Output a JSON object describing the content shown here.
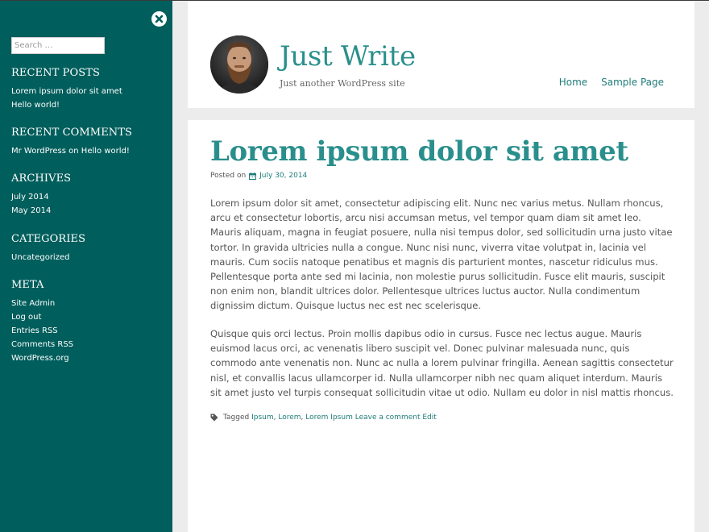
{
  "sidebar": {
    "search": {
      "placeholder": "Search …",
      "value": ""
    },
    "recent_posts": {
      "title": "Recent Posts",
      "items": [
        "Lorem ipsum dolor sit amet",
        "Hello world!"
      ]
    },
    "recent_comments": {
      "title": "Recent Comments",
      "author": "Mr WordPress",
      "connector": "on",
      "post": "Hello world!"
    },
    "archives": {
      "title": "Archives",
      "items": [
        "July 2014",
        "May 2014"
      ]
    },
    "categories": {
      "title": "Categories",
      "items": [
        "Uncategorized"
      ]
    },
    "meta": {
      "title": "Meta",
      "items": [
        "Site Admin",
        "Log out",
        "Entries RSS",
        "Comments RSS",
        "WordPress.org"
      ]
    }
  },
  "header": {
    "site_title": "Just Write",
    "site_description": "Just another WordPress site",
    "nav": [
      "Home",
      "Sample Page"
    ]
  },
  "post": {
    "title": "Lorem ipsum dolor sit amet",
    "posted_on_label": "Posted on",
    "date": "July 30, 2014",
    "paragraphs": [
      "Lorem ipsum dolor sit amet, consectetur adipiscing elit. Nunc nec varius metus. Nullam rhoncus, arcu et consectetur lobortis, arcu nisi accumsan metus, vel tempor quam diam sit amet leo. Mauris aliquam, magna in feugiat posuere, nulla nisi tempus dolor, sed sollicitudin urna justo vitae tortor. In gravida ultricies nulla a congue. Nunc nisi nunc, viverra vitae volutpat in, lacinia vel mauris. Cum sociis natoque penatibus et magnis dis parturient montes, nascetur ridiculus mus. Pellentesque porta ante sed mi lacinia, non molestie purus sollicitudin. Fusce elit mauris, suscipit non enim non, blandit ultrices dolor. Pellentesque ultrices luctus auctor. Nulla condimentum dignissim dictum. Quisque luctus nec est nec scelerisque.",
      "Quisque quis orci lectus. Proin mollis dapibus odio in cursus. Fusce nec lectus augue. Mauris euismod lacus orci, ac venenatis libero suscipit vel. Donec pulvinar malesuada nunc, quis commodo ante venenatis non. Nunc ac nulla a lorem pulvinar fringilla. Aenean sagittis consectetur nisl, et convallis lacus ullamcorper id. Nulla ullamcorper nibh nec quam aliquet interdum. Mauris sit amet justo vel turpis consequat sollicitudin vitae ut odio. Nullam eu dolor in nisl mattis rhoncus."
    ],
    "tagged_label": "Tagged",
    "tags": [
      "Ipsum",
      "Lorem",
      "Lorem Ipsum"
    ],
    "tag_separator": ",",
    "comment_link": "Leave a comment",
    "edit_link": "Edit"
  },
  "colors": {
    "sidebar_bg": "#005e5c",
    "accent": "#2a8f8c",
    "link": "#1f7d7a",
    "page_bg": "#ececec"
  },
  "icons": [
    "close-icon",
    "calendar-icon",
    "tag-icon",
    "avatar"
  ]
}
